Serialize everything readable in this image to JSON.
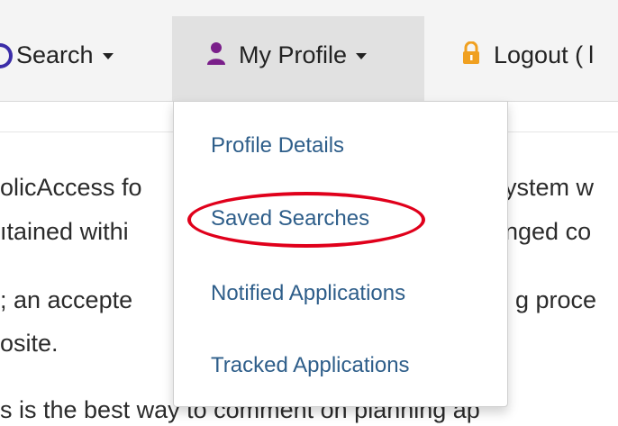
{
  "nav": {
    "search_label": "Search",
    "profile_label": "My Profile",
    "logout_label": "Logout (",
    "logout_trailing": "l"
  },
  "background_text": {
    "line1a": "olicAccess fo",
    "line1b": "ystem w",
    "line2a": "ıtained withi",
    "line2b": "nged co",
    "line3a": "; an accepte",
    "line3b": "g proce",
    "line4a": "osite.",
    "line5": "s is the best way to comment on planning ap"
  },
  "dropdown": {
    "items": [
      "Profile Details",
      "Saved Searches",
      "Notified Applications",
      "Tracked Applications"
    ]
  },
  "colors": {
    "link": "#2e5e8a",
    "highlight": "#e0001b",
    "user_icon": "#7a1f8a",
    "lock_icon": "#f0a020"
  }
}
